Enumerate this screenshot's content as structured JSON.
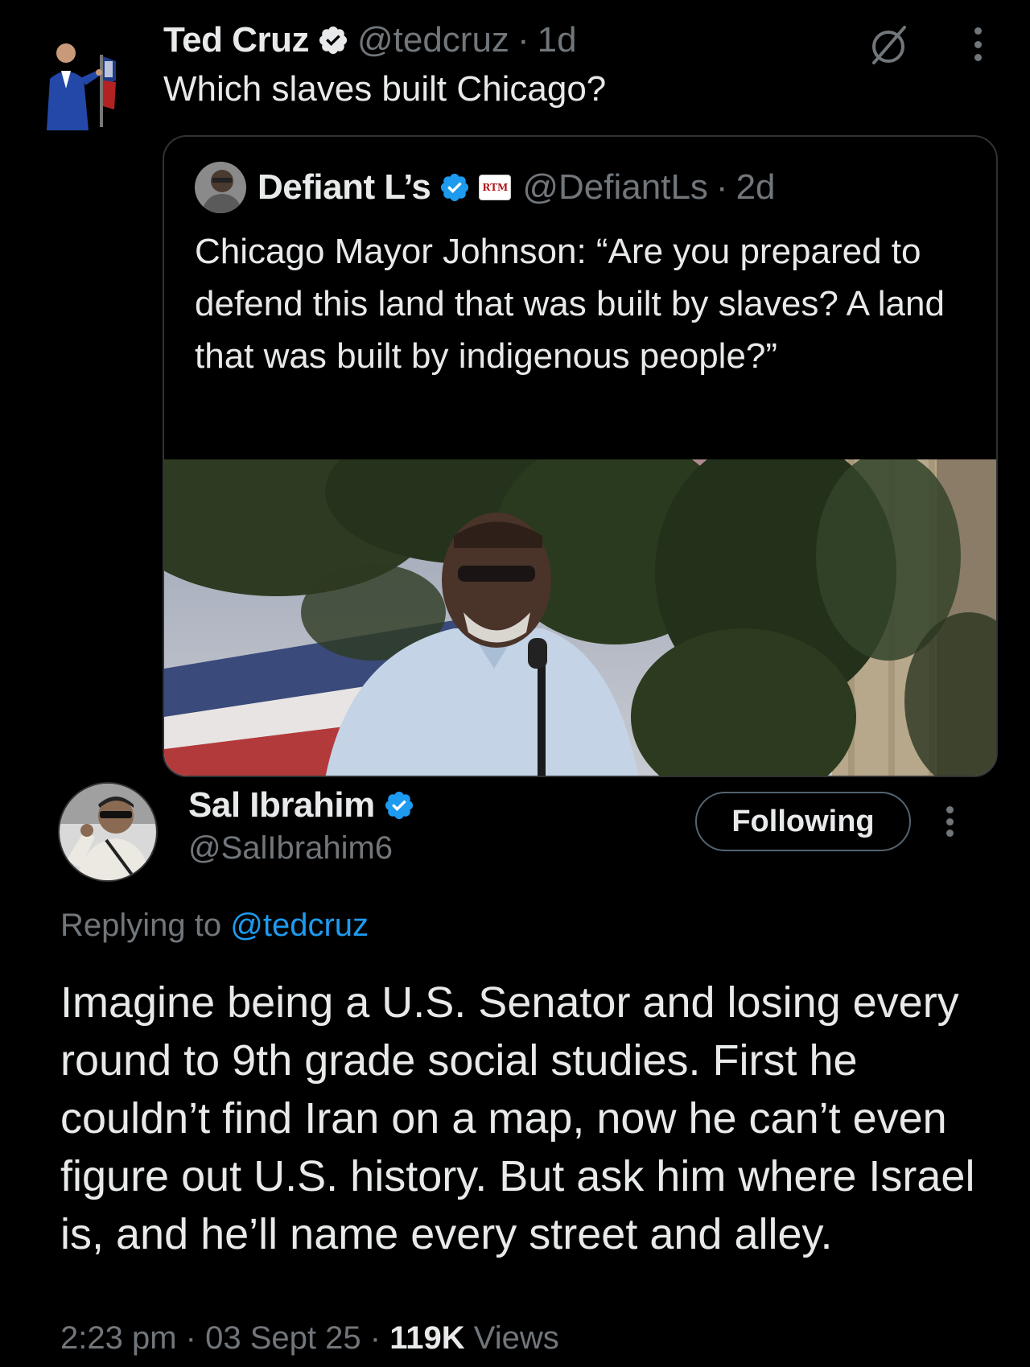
{
  "parent_tweet": {
    "author_name": "Ted Cruz",
    "handle": "@tedcruz",
    "separator": "·",
    "time_ago": "1d",
    "text": "Which slaves built Chicago?"
  },
  "quoted_tweet": {
    "author_name": "Defiant L’s",
    "affiliate_badge": "RTM",
    "handle": "@DefiantLs",
    "separator": "·",
    "time_ago": "2d",
    "text": "Chicago Mayor Johnson: “Are you prepared to defend this land that was built by slaves? A land that was built by indigenous people?”"
  },
  "reply": {
    "author_name": "Sal Ibrahim",
    "handle": "@SalIbrahim6",
    "follow_button": "Following",
    "replying_prefix": "Replying to",
    "replying_mention": "@tedcruz",
    "text": "Imagine being a U.S. Senator and losing every round to 9th grade social studies. First he couldn’t find Iran on a map, now he can’t even figure out U.S. history. But ask him where Israel is, and he’ll name every street and alley.",
    "time": "2:23 pm",
    "date": "03 Sept 25",
    "separator": "·",
    "views_count": "119K",
    "views_label": "Views"
  },
  "icons": {
    "verified": "verified-badge-icon",
    "grok": "grok-icon",
    "more": "more-vertical-icon"
  },
  "colors": {
    "background": "#000000",
    "text_primary": "#e7e9ea",
    "text_secondary": "#71767b",
    "accent_blue": "#1d9bf0",
    "border": "#2f3336"
  }
}
